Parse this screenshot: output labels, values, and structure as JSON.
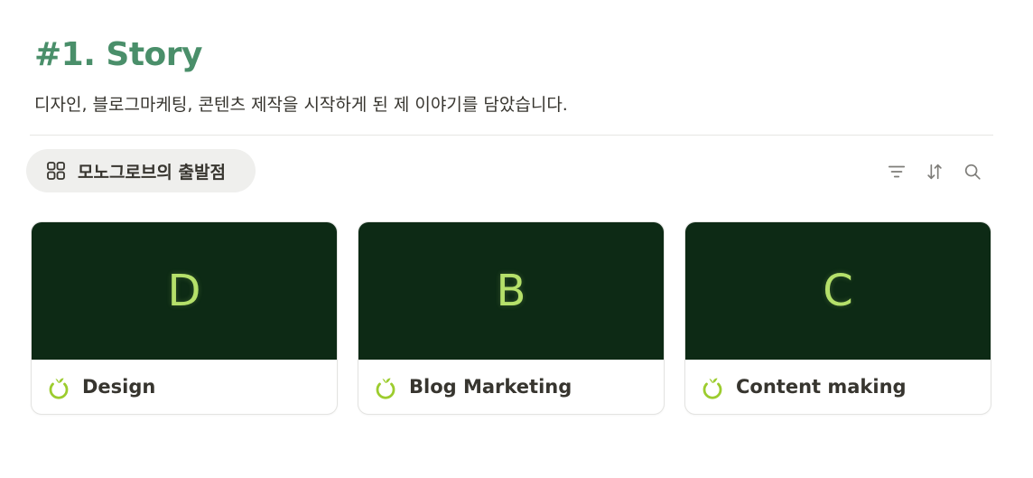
{
  "page": {
    "title": "#1. Story",
    "description": "디자인, 블로그마케팅, 콘텐츠 제작을 시작하게 된 제 이야기를 담았습니다."
  },
  "view": {
    "tab_label": "모노그로브의 출발점",
    "tab_icon": "gallery-grid-icon"
  },
  "toolbar": {
    "filter_icon": "filter-icon",
    "sort_icon": "sort-icon",
    "search_icon": "search-icon"
  },
  "cards": [
    {
      "cover_letter": "D",
      "title": "Design",
      "icon": "sprout-icon"
    },
    {
      "cover_letter": "B",
      "title": "Blog Marketing",
      "icon": "sprout-icon"
    },
    {
      "cover_letter": "C",
      "title": "Content making",
      "icon": "sprout-icon"
    }
  ],
  "colors": {
    "title": "#4a8f6a",
    "cover_background": "#0d2a15",
    "cover_letter": "#b5e06a",
    "sprout_icon": "#9ccc2e",
    "tab_background": "#efefed"
  }
}
